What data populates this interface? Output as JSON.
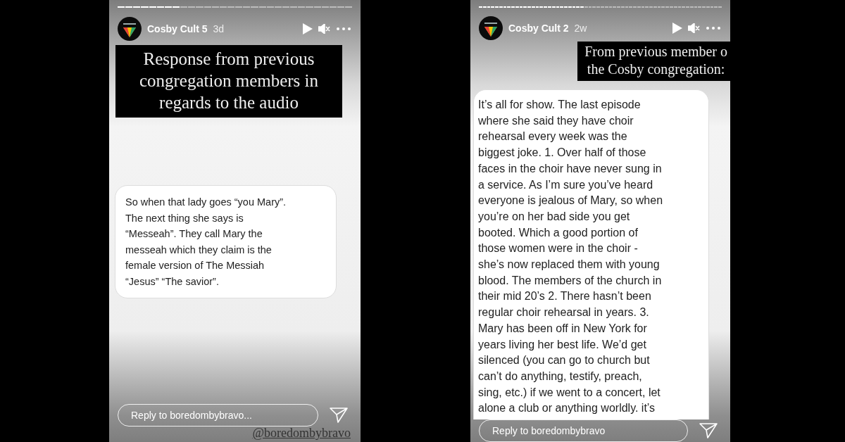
{
  "stories": [
    {
      "account": "Cosby Cult 5",
      "age": "3d",
      "banner": [
        "Response from previous",
        "congregation members in",
        "regards to the audio"
      ],
      "message": [
        "So when that lady goes “you Mary”.",
        "The next thing she says is",
        "“Messeah”.   They call Mary the",
        "messeah which they claim is the",
        "female version of The Messiah",
        "“Jesus” “The savior”."
      ],
      "reply": {
        "placeholder": "Reply to boredombybravo..."
      },
      "handle": "@boredombybravo"
    },
    {
      "account": "Cosby Cult 2",
      "age": "2w",
      "banner": [
        "From previous member o",
        "the Cosby congregation:"
      ],
      "message": [
        "It’s all for show. The last episode",
        "where she said they have choir",
        "rehearsal every week was the",
        "biggest joke. 1. Over half of those",
        "faces in the choir have never sung in",
        "a service. As I’m sure you’ve heard",
        "everyone is jealous of Mary, so when",
        "you’re on her bad side you get",
        "booted. Which a good portion of",
        "those women were in the choir -",
        "she’s now replaced them with young",
        "blood. The members of the church in",
        "their mid 20’s 2. There hasn’t been",
        "regular choir rehearsal in years. 3.",
        "Mary has been off in New York for",
        "years living her best life. We’d get",
        "silenced (you can go to church but",
        "can’t do anything, testify, preach,",
        "sing, etc.) if we went to a concert, let",
        "alone a club or anything worldly. it’s"
      ],
      "reply": {
        "placeholder": "Reply to boredombybravo"
      }
    }
  ]
}
